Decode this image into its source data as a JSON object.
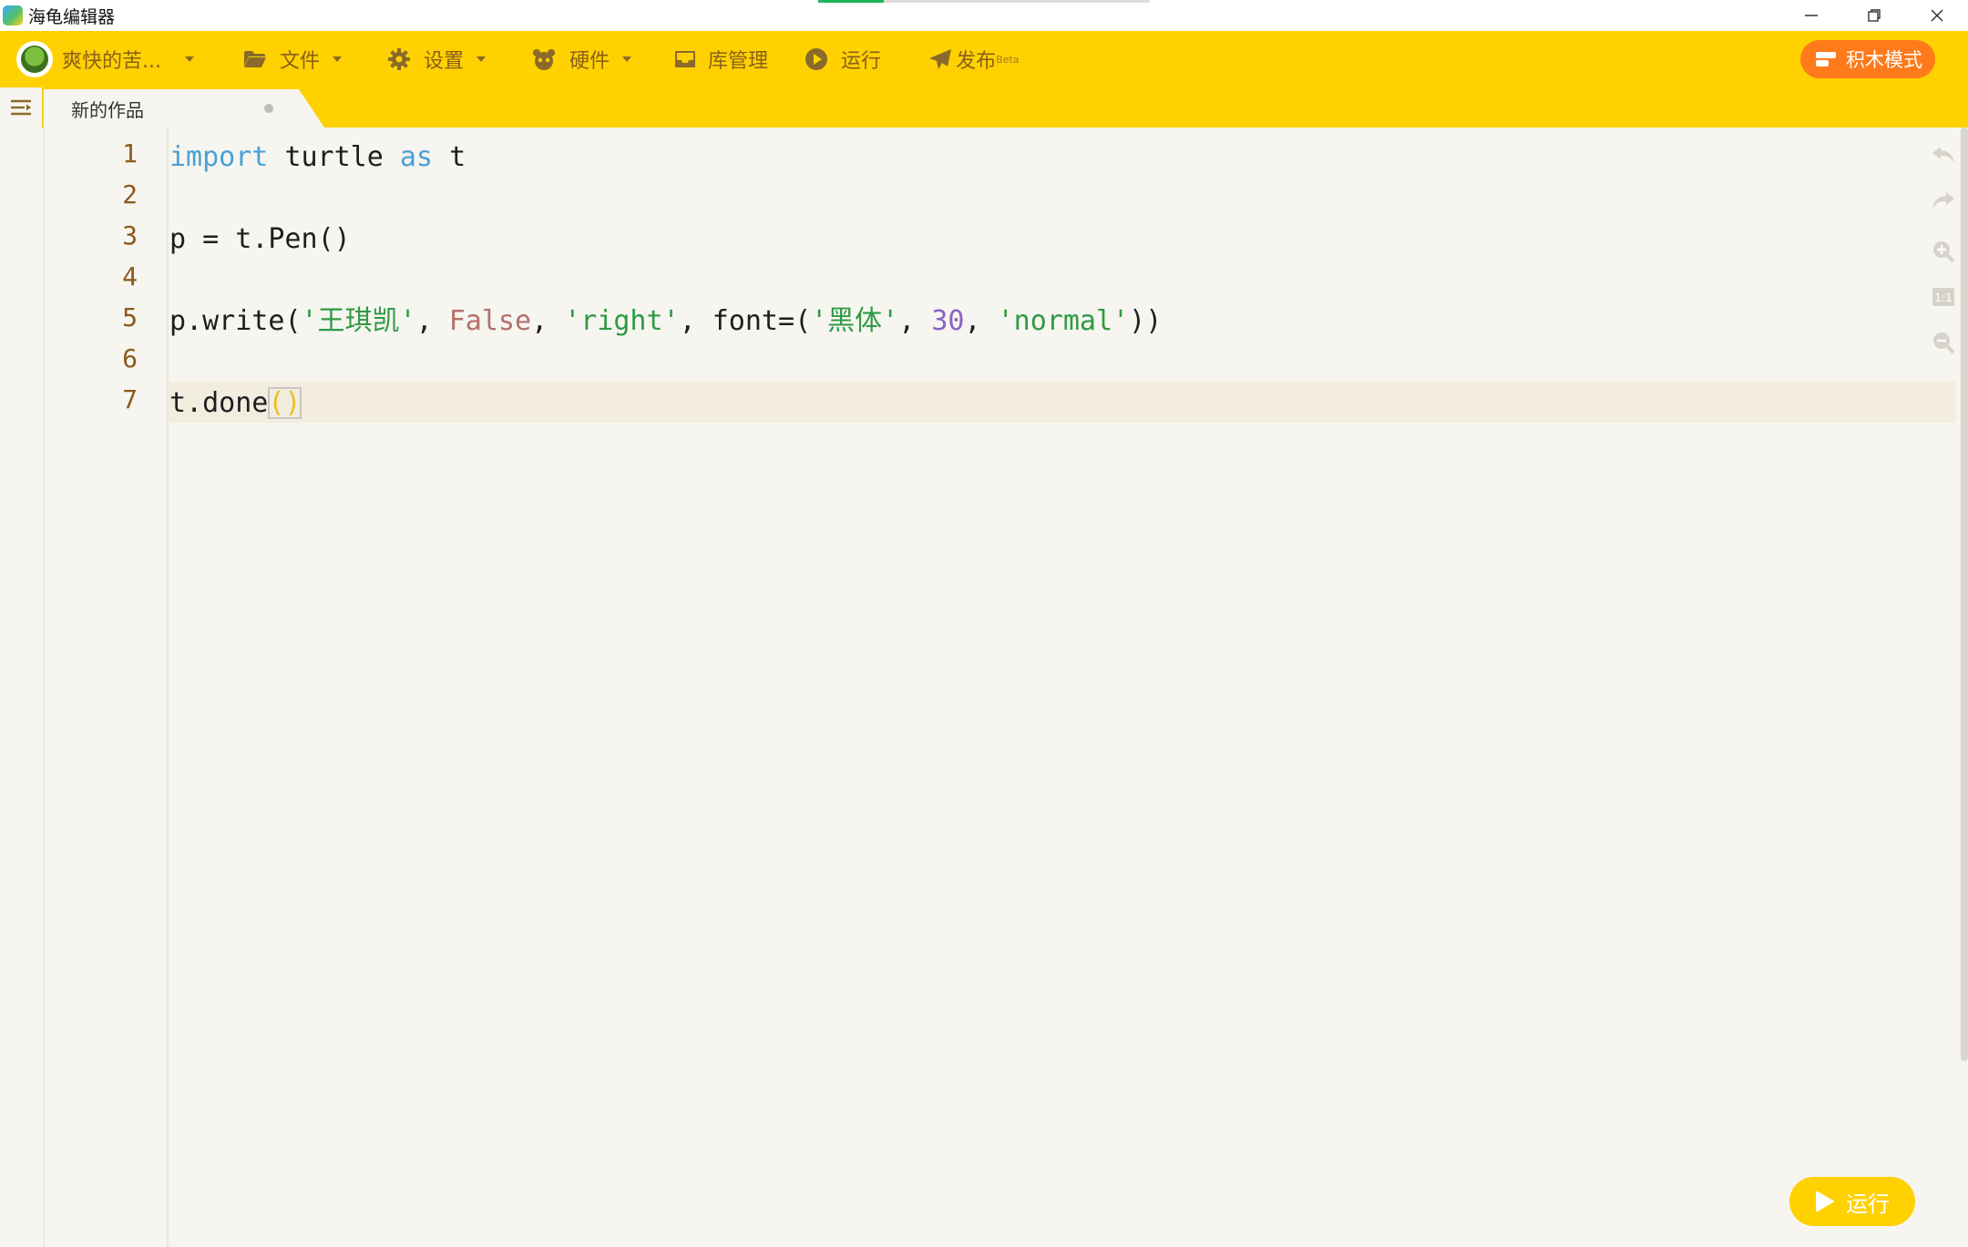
{
  "window": {
    "title": "海龟编辑器",
    "controls": [
      "minimize",
      "restore",
      "close"
    ]
  },
  "toolbar": {
    "user_name": "爽快的苦...",
    "file_label": "文件",
    "settings_label": "设置",
    "hardware_label": "硬件",
    "library_label": "库管理",
    "run_label": "运行",
    "publish_label": "发布",
    "publish_badge": "Beta",
    "mode_button_label": "积木模式"
  },
  "tabs": [
    {
      "title": "新的作品",
      "modified": true
    }
  ],
  "editor": {
    "language": "python",
    "line_numbers": [
      "1",
      "2",
      "3",
      "4",
      "5",
      "6",
      "7"
    ],
    "active_line": 7,
    "lines": [
      "import turtle as t",
      "",
      "p = t.Pen()",
      "",
      "p.write('王琪凯', False, 'right', font=('黑体', 30, 'normal'))",
      "",
      "t.done()"
    ]
  },
  "side_tools": [
    "undo-icon",
    "redo-icon",
    "zoom-in-icon",
    "reset-zoom-icon",
    "zoom-out-icon"
  ],
  "run_button_label": "运行",
  "colors": {
    "toolbar_bg": "#ffd100",
    "mode_button_bg": "#ff7a1a",
    "editor_bg": "#f6f5f0",
    "keyword": "#4aa0d5",
    "string": "#2f9a44",
    "boolean": "#b4706b",
    "number": "#8a63c6",
    "line_number": "#8b5a1b"
  }
}
